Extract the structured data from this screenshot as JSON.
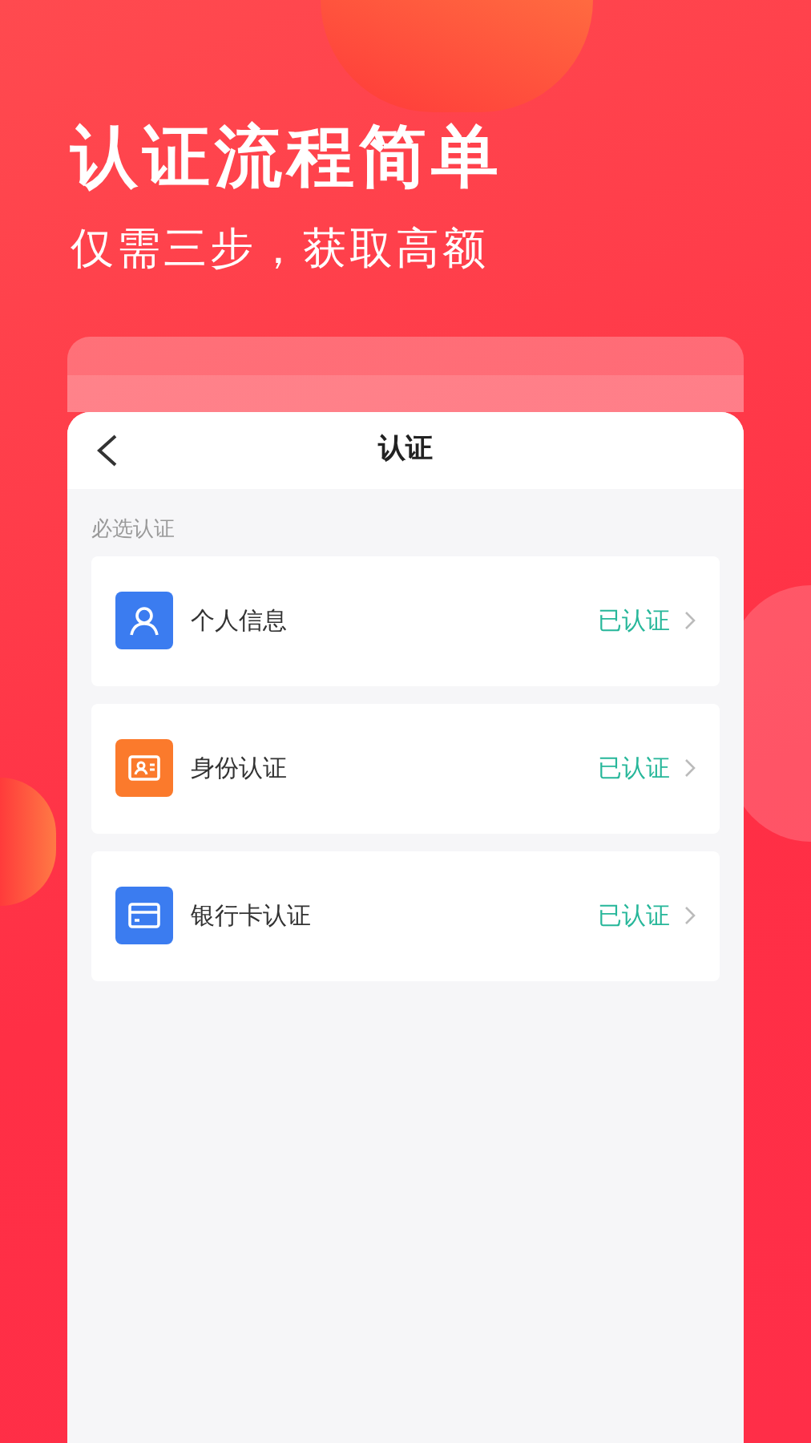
{
  "headline": "认证流程简单",
  "subheadline": "仅需三步，获取高额",
  "screen": {
    "title": "认证",
    "section_label": "必选认证",
    "items": [
      {
        "kind": "person",
        "color": "#3b7cf0",
        "label": "个人信息",
        "status": "已认证"
      },
      {
        "kind": "idcard",
        "color": "#fb7a2c",
        "label": "身份认证",
        "status": "已认证"
      },
      {
        "kind": "bankcard",
        "color": "#3b7cf0",
        "label": "银行卡认证",
        "status": "已认证"
      }
    ]
  }
}
